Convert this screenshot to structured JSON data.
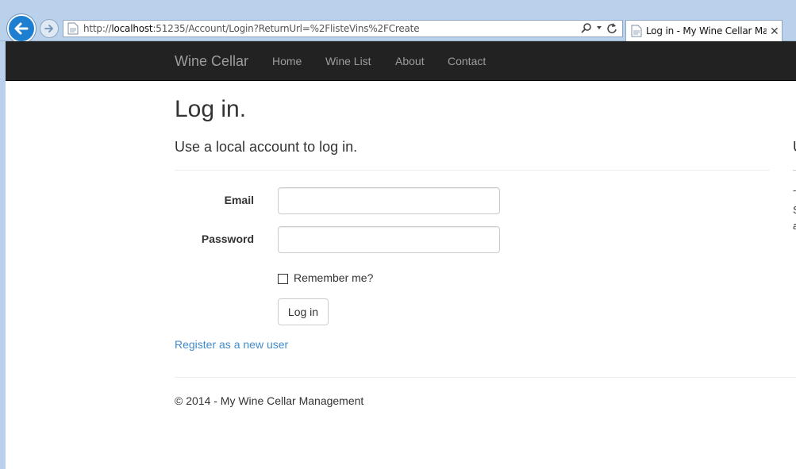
{
  "browser": {
    "url_prefix": "http://",
    "url_host": "localhost",
    "url_rest": ":51235/Account/Login?ReturnUrl=%2FlisteVins%2FCreate",
    "tab_title": "Log in - My Wine Cellar Ma...",
    "tab_close": "✕"
  },
  "navbar": {
    "brand": "Wine Cellar",
    "links": [
      "Home",
      "Wine List",
      "About",
      "Contact"
    ]
  },
  "page": {
    "title": "Log in.",
    "subtitle": "Use a local account to log in.",
    "side_heading_fragment": "U",
    "side_text_fragments": [
      "-",
      "S",
      "a"
    ]
  },
  "form": {
    "email_label": "Email",
    "email_value": "",
    "password_label": "Password",
    "password_value": "",
    "remember_label": "Remember me?",
    "remember_checked": false,
    "submit_label": "Log in"
  },
  "register_link": "Register as a new user",
  "footer": "© 2014 - My Wine Cellar Management",
  "colors": {
    "chrome": "#b9d1ea",
    "navbar": "#222222",
    "nav_text": "#9d9d9d",
    "link": "#428bca"
  }
}
